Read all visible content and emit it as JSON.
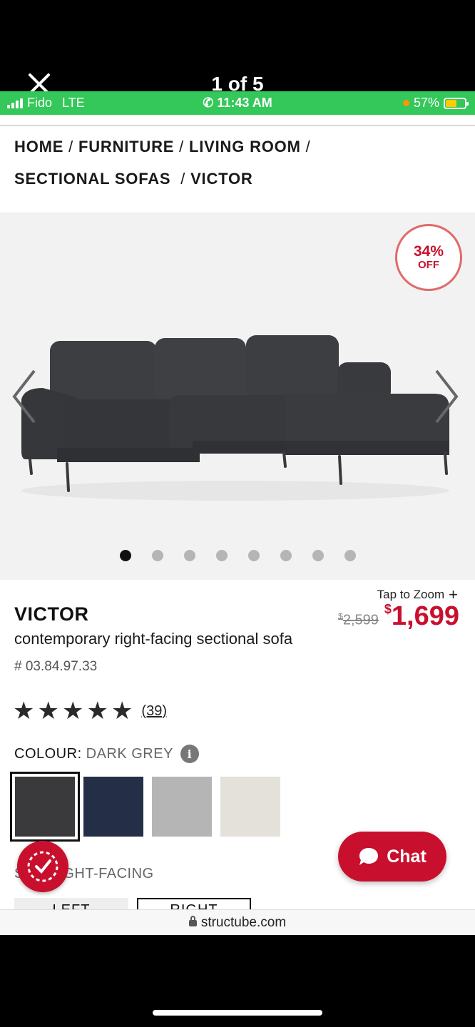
{
  "viewer": {
    "counter": "1 of 5"
  },
  "status_bar": {
    "carrier": "Fido",
    "network": "LTE",
    "time": "11:43 AM",
    "battery": "57%",
    "battery_level": 0.57,
    "bar_color": "#34c759"
  },
  "breadcrumb": {
    "items": [
      "HOME",
      "FURNITURE",
      "LIVING ROOM",
      "SECTIONAL SOFAS",
      "VICTOR"
    ]
  },
  "gallery": {
    "discount_pct": "34%",
    "discount_off": "OFF",
    "dots_total": 8,
    "active_dot": 0
  },
  "product": {
    "zoom_label": "Tap to Zoom",
    "name": "VICTOR",
    "description": "contemporary right-facing sectional sofa",
    "sku": "# 03.84.97.33",
    "old_price_currency": "$",
    "old_price": "2,599",
    "price_currency": "$",
    "price": "1,699",
    "accent_color": "#c8102e",
    "rating_stars": 5,
    "review_count": "(39)"
  },
  "colour": {
    "label": "COLOUR:",
    "value": "DARK GREY",
    "swatches": [
      "dark grey",
      "navy",
      "light grey",
      "cream"
    ],
    "selected": 0
  },
  "orientation": {
    "label_visible": "GHT-FACING",
    "prefix": "S",
    "options": [
      "LEFT",
      "RIGHT"
    ]
  },
  "chat": {
    "label": "Chat"
  },
  "url": {
    "domain": "structube.com"
  }
}
